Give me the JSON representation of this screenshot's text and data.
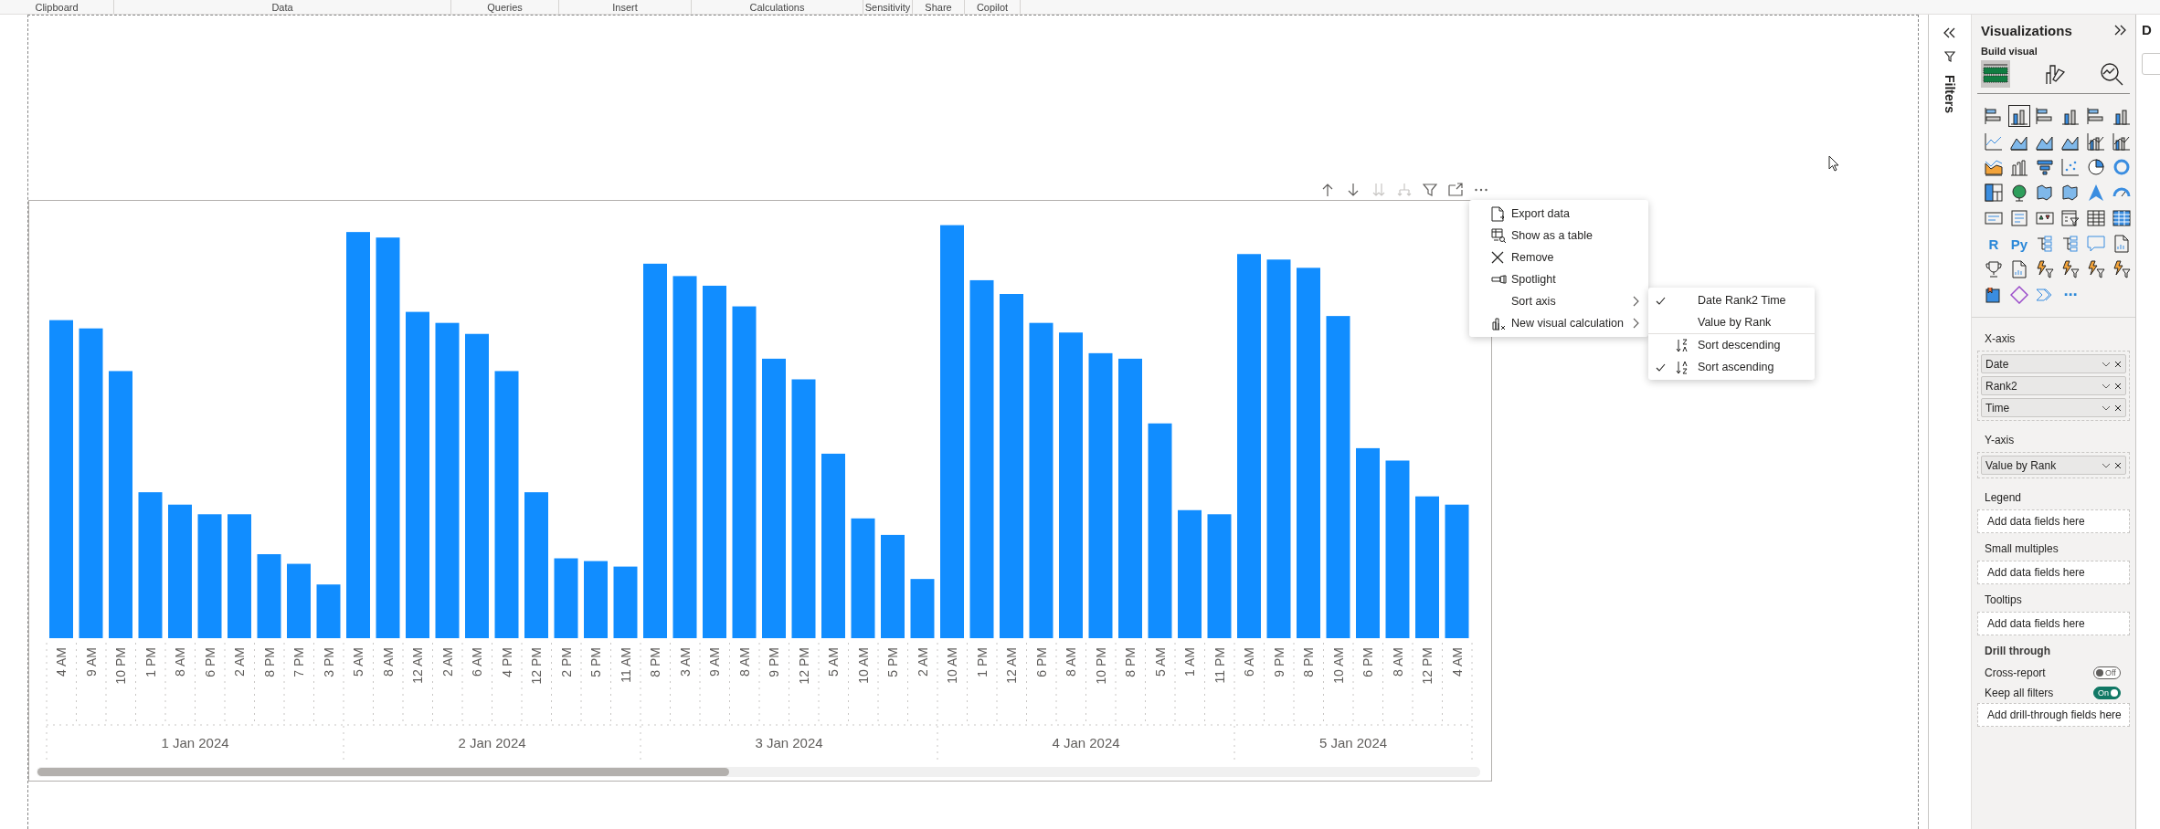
{
  "ribbon_groups": [
    "Clipboard",
    "Data",
    "Queries",
    "Insert",
    "Calculations",
    "Sensitivity",
    "Share",
    "Copilot"
  ],
  "visual_header": [
    {
      "kind": "up",
      "disabled": false
    },
    {
      "kind": "down",
      "disabled": false
    },
    {
      "kind": "double-down",
      "disabled": true
    },
    {
      "kind": "expand",
      "disabled": true
    },
    {
      "kind": "filter",
      "disabled": false
    },
    {
      "kind": "focus",
      "disabled": false
    },
    {
      "kind": "more",
      "disabled": false
    }
  ],
  "chart": {
    "groups": [
      {
        "date": "1 Jan 2024",
        "times": [
          "4 AM",
          "9 AM",
          "10 PM",
          "1 PM",
          "8 AM",
          "6 PM",
          "2 AM",
          "8 PM",
          "7 PM",
          "3 PM"
        ]
      },
      {
        "date": "2 Jan 2024",
        "times": [
          "5 AM",
          "8 AM",
          "12 AM",
          "2 AM",
          "6 AM",
          "4 PM",
          "12 PM",
          "2 PM",
          "5 PM",
          "11 AM"
        ]
      },
      {
        "date": "3 Jan 2024",
        "times": [
          "8 PM",
          "3 AM",
          "9 AM",
          "8 AM",
          "9 PM",
          "12 PM",
          "5 AM",
          "10 AM",
          "5 PM",
          "2 AM"
        ]
      },
      {
        "date": "4 Jan 2024",
        "times": [
          "10 AM",
          "1 PM",
          "12 AM",
          "6 PM",
          "8 AM",
          "10 PM",
          "8 PM",
          "5 AM",
          "1 AM",
          "11 PM"
        ]
      },
      {
        "date": "5 Jan 2024",
        "times": [
          "6 AM",
          "9 PM",
          "8 PM",
          "10 AM",
          "6 PM",
          "8 AM",
          "12 PM",
          "4 AM"
        ]
      }
    ]
  },
  "context_menu": [
    {
      "label": "Export data",
      "kind": "export",
      "submenu": false
    },
    {
      "label": "Show as a table",
      "kind": "table",
      "submenu": false
    },
    {
      "label": "Remove",
      "kind": "remove",
      "submenu": false
    },
    {
      "label": "Spotlight",
      "kind": "spotlight",
      "submenu": false
    },
    {
      "label": "Sort axis",
      "kind": "none",
      "submenu": true
    },
    {
      "label": "New visual calculation",
      "kind": "calculation",
      "submenu": true
    }
  ],
  "sort_submenu": [
    {
      "label": "Date Rank2 Time",
      "kind": "field",
      "checked": true
    },
    {
      "label": "Value by Rank",
      "kind": "field",
      "checked": false
    },
    {
      "label": "Sort descending",
      "kind": "descending",
      "checked": false
    },
    {
      "label": "Sort ascending",
      "kind": "ascending",
      "checked": true
    }
  ],
  "filters_pane": {
    "title": "Filters"
  },
  "visualizations": {
    "title": "Visualizations",
    "subtitle": "Build visual",
    "build_tabs": [
      {
        "kind": "fields",
        "selected": true
      },
      {
        "kind": "format",
        "selected": false
      },
      {
        "kind": "analytics",
        "selected": false
      }
    ],
    "visual_types": [
      {
        "kind": "hbar",
        "selected": false
      },
      {
        "kind": "column",
        "selected": true
      },
      {
        "kind": "hbar",
        "selected": false
      },
      {
        "kind": "column",
        "selected": false
      },
      {
        "kind": "hbar",
        "selected": false
      },
      {
        "kind": "column",
        "selected": false
      },
      {
        "kind": "line",
        "selected": false
      },
      {
        "kind": "area",
        "selected": false
      },
      {
        "kind": "area",
        "selected": false
      },
      {
        "kind": "area",
        "selected": false
      },
      {
        "kind": "combo",
        "selected": false
      },
      {
        "kind": "combo",
        "selected": false
      },
      {
        "kind": "ribbon",
        "selected": false
      },
      {
        "kind": "waterfall",
        "selected": false
      },
      {
        "kind": "funnel",
        "selected": false
      },
      {
        "kind": "scatter",
        "selected": false
      },
      {
        "kind": "pie",
        "selected": false
      },
      {
        "kind": "donut",
        "selected": false
      },
      {
        "kind": "treemap",
        "selected": false
      },
      {
        "kind": "globe",
        "selected": false
      },
      {
        "kind": "map",
        "selected": false
      },
      {
        "kind": "map",
        "selected": false
      },
      {
        "kind": "arrow",
        "selected": false
      },
      {
        "kind": "gauge",
        "selected": false
      },
      {
        "kind": "card",
        "selected": false
      },
      {
        "kind": "list",
        "selected": false
      },
      {
        "kind": "kpi",
        "selected": false
      },
      {
        "kind": "slicer",
        "selected": false
      },
      {
        "kind": "table",
        "selected": false
      },
      {
        "kind": "matrix",
        "selected": false
      },
      {
        "kind": "text",
        "label": "R",
        "selected": false
      },
      {
        "kind": "text",
        "label": "Py",
        "selected": false
      },
      {
        "kind": "tree",
        "selected": false
      },
      {
        "kind": "tree",
        "selected": false
      },
      {
        "kind": "speech",
        "selected": false
      },
      {
        "kind": "document",
        "selected": false
      },
      {
        "kind": "trophy",
        "selected": false
      },
      {
        "kind": "document",
        "selected": false
      },
      {
        "kind": "lightning",
        "selected": false
      },
      {
        "kind": "lightning",
        "selected": false
      },
      {
        "kind": "lightning",
        "selected": false
      },
      {
        "kind": "lightning",
        "selected": false
      },
      {
        "kind": "app",
        "selected": false
      },
      {
        "kind": "diamond",
        "selected": false
      },
      {
        "kind": "chevron",
        "selected": false
      },
      {
        "kind": "text",
        "label": "⋯",
        "selected": false
      }
    ],
    "wells": [
      {
        "label": "X-axis",
        "fields": [
          "Date",
          "Rank2",
          "Time"
        ]
      },
      {
        "label": "Y-axis",
        "fields": [
          "Value by Rank"
        ]
      },
      {
        "label": "Legend",
        "hint": "Add data fields here"
      },
      {
        "label": "Small multiples",
        "hint": "Add data fields here"
      },
      {
        "label": "Tooltips",
        "hint": "Add data fields here"
      }
    ],
    "drill_through": {
      "title": "Drill through",
      "toggles": [
        {
          "label": "Cross-report",
          "on": false,
          "state_text": "Off"
        },
        {
          "label": "Keep all filters",
          "on": true,
          "state_text": "On"
        }
      ],
      "hint": "Add drill-through fields here"
    }
  },
  "data_pane": {
    "title": "D"
  }
}
